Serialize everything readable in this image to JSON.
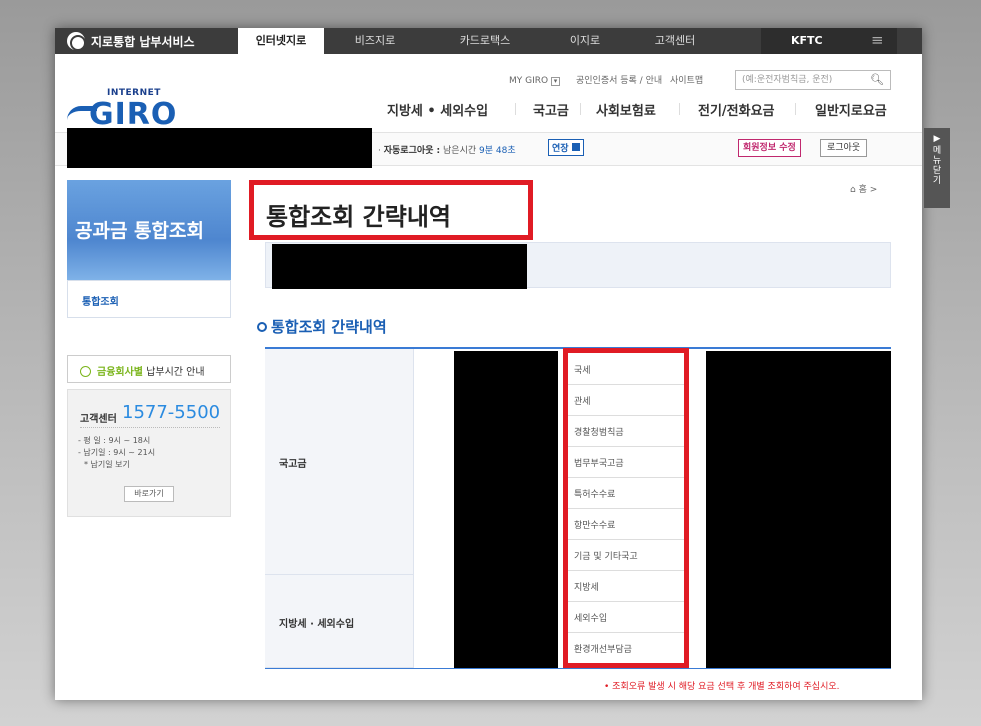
{
  "topnav": {
    "brand": "지로통합 납부서비스",
    "tabs": [
      "인터넷지로",
      "비즈지로",
      "카드로택스",
      "이지로",
      "고객센터"
    ],
    "kftc": "KFTC",
    "menu_icon": "≡"
  },
  "logo": {
    "small": "INTERNET",
    "big": "GIRO"
  },
  "utils": {
    "mygiro": "MY GIRO",
    "cert": "공인인증서 등록 / 안내",
    "sitemap": "사이트맵",
    "search_placeholder": "(예:운전자범칙금, 운전)"
  },
  "gnb": [
    "지방세 • 세외수입",
    "국고금",
    "사회보험료",
    "전기/전화요금",
    "일반지로요금"
  ],
  "login": {
    "autologout_label": "자동로그아웃 :",
    "remaining": "남은시간",
    "time": "9분 48초",
    "extend": "연장",
    "member_edit": "회원정보 수정",
    "logout": "로그아웃"
  },
  "sidebar": {
    "title": "공과금 통합조회",
    "item": "통합조회",
    "notice_green": "금융회사별",
    "notice_rest": "납부시간 안내",
    "cs_label": "고객센터",
    "cs_number": "1577-5500",
    "hours": [
      "- 평  일 : 9시 ~ 18시",
      "- 납기일 : 9시 ~ 21시",
      "* 납기일 보기"
    ],
    "go": "바로가기"
  },
  "main": {
    "title": "통합조회 간략내역",
    "breadcrumb": "⌂ 홈 >",
    "sub_title": "통합조회 간략내역",
    "rows": [
      {
        "label": "국고금"
      },
      {
        "label": "지방세 · 세외수입"
      }
    ],
    "codes": [
      "국세",
      "관세",
      "경찰청범칙금",
      "법무부국고금",
      "특허수수료",
      "항만수수료",
      "기금 및 기타국고",
      "지방세",
      "세외수입",
      "환경개선부담금"
    ],
    "footnote": "• 조회오류 발생 시 해당 요금 선택 후 개별 조회하여 주십시오."
  },
  "side_tab": {
    "arrow": "▶",
    "label": "메뉴닫기"
  }
}
